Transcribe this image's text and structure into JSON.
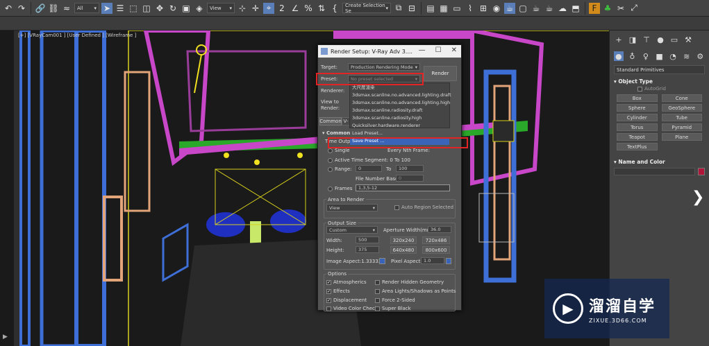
{
  "toolbar": {
    "filter_value": "All",
    "view_value": "View",
    "selection_set_value": "Create Selection Se",
    "icons": [
      "undo-icon",
      "redo-icon",
      "link-icon",
      "unlink-icon",
      "bind-icon",
      "select-icon",
      "select-by-name-icon",
      "region-select-icon",
      "window-crossing-icon",
      "move-icon",
      "rotate-icon",
      "scale-icon",
      "pivot-icon",
      "snap-icon",
      "angle-snap-icon",
      "percent-snap-icon",
      "spinner-snap-icon",
      "mirror-icon",
      "align-icon",
      "layer-icon",
      "graph-icon",
      "material-editor-icon",
      "render-setup-icon",
      "rendered-frame-icon",
      "render-icon",
      "render-iterative-icon"
    ]
  },
  "viewport": {
    "label": "[+] [VRayCam001 ] [User Defined ] [Wireframe ]"
  },
  "right_panel": {
    "category_dropdown": "Standard Primitives",
    "object_type_title": "Object Type",
    "autogrid_label": "AutoGrid",
    "buttons": [
      "Box",
      "Cone",
      "Sphere",
      "GeoSphere",
      "Cylinder",
      "Tube",
      "Torus",
      "Pyramid",
      "Teapot",
      "Plane",
      "TextPlus"
    ],
    "name_color_title": "Name and Color",
    "name_color_swatch": "#b0163a"
  },
  "dialog": {
    "title": "Render Setup: V-Ray Adv 3....",
    "target_label": "Target:",
    "target_value": "Production Rendering Mode",
    "preset_label": "Preset:",
    "preset_value": "No preset selected",
    "renderer_label": "Renderer:",
    "view_to_render_label": "View to\nRender:",
    "render_button": "Render",
    "tab_common": "Common",
    "tab_vray": "V-",
    "section_common": "Common",
    "time_output_label": "Time Outp",
    "preset_options": [
      "大尺度渲染",
      "3dsmax.scanline.no.advanced.lighting.draft",
      "3dsmax.scanline.no.advanced.lighting.high",
      "3dsmax.scanline.radiosity.draft",
      "3dsmax.scanline.radiosity.high",
      "Quicksilver.hardware.renderer",
      "Load Preset...",
      "Save Preset ..."
    ],
    "single_label": "Single",
    "every_nth_label": "Every Nth Frame:",
    "active_segment_label": "Active Time Segment:",
    "active_segment_value": "0 To 100",
    "range_label": "Range:",
    "range_from": "0",
    "range_to_label": "To",
    "range_to": "100",
    "file_number_base_label": "File Number Base:",
    "file_number_base_value": "0",
    "frames_label": "Frames",
    "frames_value": "1,3,5-12",
    "area_to_render_label": "Area to Render",
    "area_value": "View",
    "auto_region_label": "Auto Region Selected",
    "output_size_label": "Output Size",
    "output_size_value": "Custom",
    "aperture_label": "Aperture Width(mm):",
    "aperture_value": "36.0",
    "width_label": "Width:",
    "width_value": "500",
    "height_label": "Height:",
    "height_value": "375",
    "preset_sizes": [
      "320x240",
      "720x486",
      "640x480",
      "800x600"
    ],
    "image_aspect_label": "Image Aspect:",
    "image_aspect_value": "1.33333",
    "pixel_aspect_label": "Pixel Aspect:",
    "pixel_aspect_value": "1.0",
    "options_label": "Options",
    "opt_atmospherics": "Atmospherics",
    "opt_render_hidden": "Render Hidden Geometry",
    "opt_effects": "Effects",
    "opt_area_lights": "Area Lights/Shadows as Points",
    "opt_displacement": "Displacement",
    "opt_force_2sided": "Force 2-Sided",
    "opt_video_color": "Video Color Check",
    "opt_super_black": "Super Black"
  },
  "watermark": {
    "title": "溜溜自学",
    "url": "ZIXUE.3D66.COM"
  }
}
